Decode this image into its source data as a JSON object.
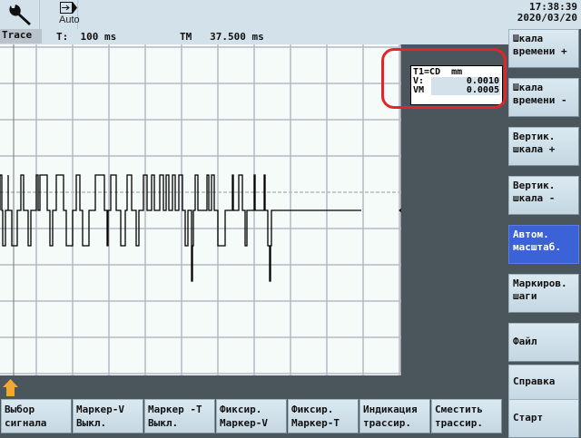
{
  "header": {
    "auto_label": "Auto",
    "time": "17:38:39",
    "date": "2020/03/20"
  },
  "status": {
    "tab": "Trace",
    "t_label": "T:  100 ms",
    "tm_label": "TM   37.500 ms"
  },
  "info_box": {
    "title": "T1=CD  mm",
    "v_label": "V:",
    "v_value": "0.0010",
    "vm_label": "VM",
    "vm_value": "0.0005"
  },
  "colors": {
    "accent": "#3b62d6",
    "highlight": "#e3242b",
    "panel": "#d2e1ea",
    "plot_bg": "#f4fbf8"
  },
  "sidebar": [
    {
      "l1": "Шкала",
      "l2": "времени +"
    },
    {
      "l1": "Шкала",
      "l2": "времени -"
    },
    {
      "l1": "Вертик.",
      "l2": "шкала +"
    },
    {
      "l1": "Вертик.",
      "l2": "шкала -"
    },
    {
      "l1": "Автом.",
      "l2": "масштаб.",
      "active": true
    },
    {
      "l1": "Маркиров.",
      "l2": "шаги"
    },
    {
      "l1": "Файл",
      "l2": ""
    },
    {
      "l1": "Справка",
      "l2": ""
    },
    {
      "l1": "Старт",
      "l2": ""
    }
  ],
  "bottom": [
    {
      "l1": "Выбор",
      "l2": "сигнала"
    },
    {
      "l1": "Маркер-V",
      "l2": "Выкл."
    },
    {
      "l1": "Маркер -T",
      "l2": "Выкл."
    },
    {
      "l1": "Фиксир.",
      "l2": "Маркер-V"
    },
    {
      "l1": "Фиксир.",
      "l2": "Маркер-T"
    },
    {
      "l1": "Индикация",
      "l2": "трассир."
    },
    {
      "l1": "Сместить",
      "l2": "трассир."
    }
  ]
}
